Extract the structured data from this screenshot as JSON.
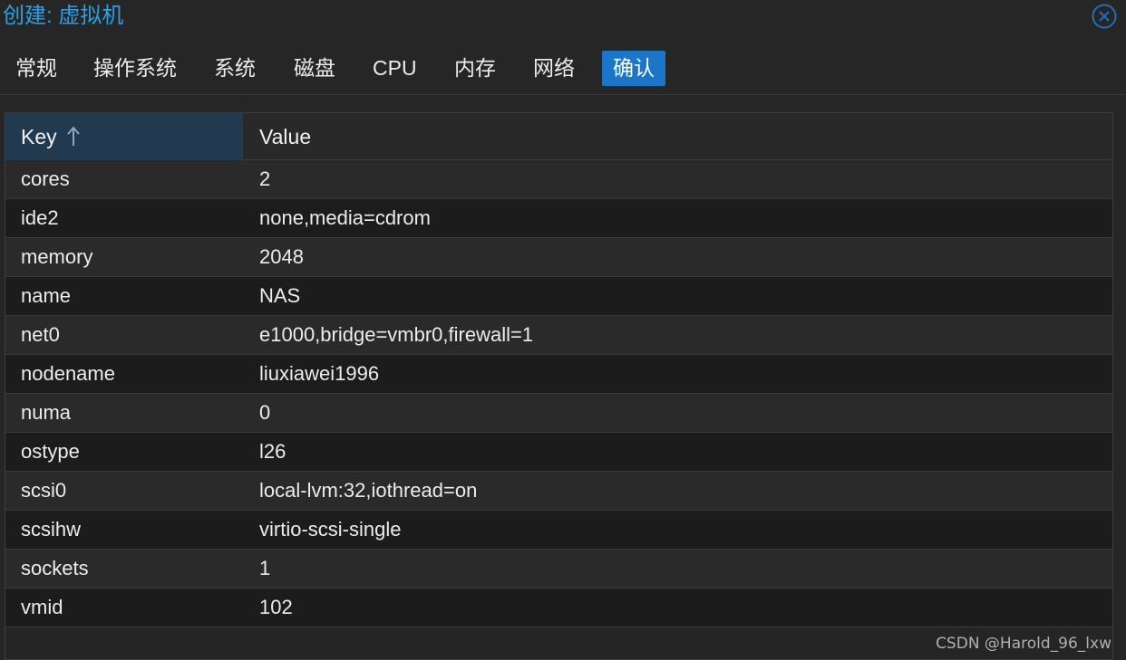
{
  "window": {
    "title": "创建: 虚拟机"
  },
  "tabs": [
    {
      "label": "常规",
      "active": false
    },
    {
      "label": "操作系统",
      "active": false
    },
    {
      "label": "系统",
      "active": false
    },
    {
      "label": "磁盘",
      "active": false
    },
    {
      "label": "CPU",
      "active": false
    },
    {
      "label": "内存",
      "active": false
    },
    {
      "label": "网络",
      "active": false
    },
    {
      "label": "确认",
      "active": true
    }
  ],
  "grid": {
    "columns": {
      "key": "Key",
      "value": "Value",
      "sort_icon": "arrow-up-icon"
    },
    "rows": [
      {
        "key": "cores",
        "value": "2"
      },
      {
        "key": "ide2",
        "value": "none,media=cdrom"
      },
      {
        "key": "memory",
        "value": "2048"
      },
      {
        "key": "name",
        "value": "NAS"
      },
      {
        "key": "net0",
        "value": "e1000,bridge=vmbr0,firewall=1"
      },
      {
        "key": "nodename",
        "value": "liuxiawei1996"
      },
      {
        "key": "numa",
        "value": "0"
      },
      {
        "key": "ostype",
        "value": "l26"
      },
      {
        "key": "scsi0",
        "value": "local-lvm:32,iothread=on"
      },
      {
        "key": "scsihw",
        "value": "virtio-scsi-single"
      },
      {
        "key": "sockets",
        "value": "1"
      },
      {
        "key": "vmid",
        "value": "102"
      }
    ]
  },
  "watermark": "CSDN @Harold_96_lxw",
  "colors": {
    "accent": "#2c9fe6",
    "active_tab": "#1b75c8",
    "sorted_header": "#213a50",
    "background": "#262626"
  }
}
